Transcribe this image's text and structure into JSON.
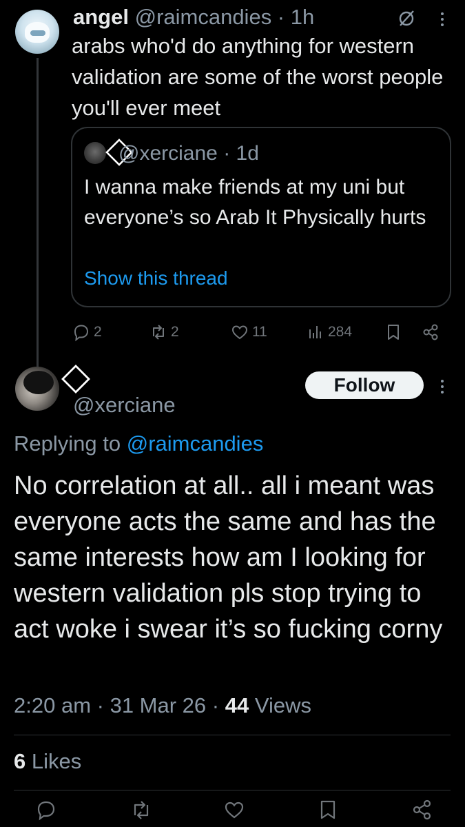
{
  "quoted_tweet": {
    "author_name": "angel",
    "author_handle": "@raimcandies",
    "time": "1h",
    "text": "arabs who'd do anything for western validation are some of the worst people you'll ever meet",
    "quote": {
      "handle": "@xerciane",
      "time": "1d",
      "text": "I wanna make friends at my uni but everyone’s so Arab It Physically hurts",
      "link": "Show this thread"
    },
    "actions": {
      "replies": "2",
      "retweets": "2",
      "likes": "11",
      "views": "284"
    }
  },
  "reply_tweet": {
    "handle": "@xerciane",
    "follow_label": "Follow",
    "replying_prefix": "Replying to",
    "replying_to": "@raimcandies",
    "text": "No correlation at all.. all i meant was everyone acts the same and has the same interests how am I looking for western validation pls stop trying to act woke i swear it’s so fucking corny",
    "time": "2:20 am",
    "date": "31 Mar 26",
    "views_count": "44",
    "views_label": "Views",
    "likes_count": "6",
    "likes_label": "Likes"
  },
  "colors": {
    "background": "#000000",
    "text": "#e7e9ea",
    "secondary": "#8b98a5",
    "accent": "#1d9bf0",
    "border": "#2f3336"
  },
  "icons": [
    "mute-icon",
    "more-icon",
    "reply-icon",
    "retweet-icon",
    "like-icon",
    "views-icon",
    "bookmark-icon",
    "share-icon",
    "diamond-icon"
  ]
}
